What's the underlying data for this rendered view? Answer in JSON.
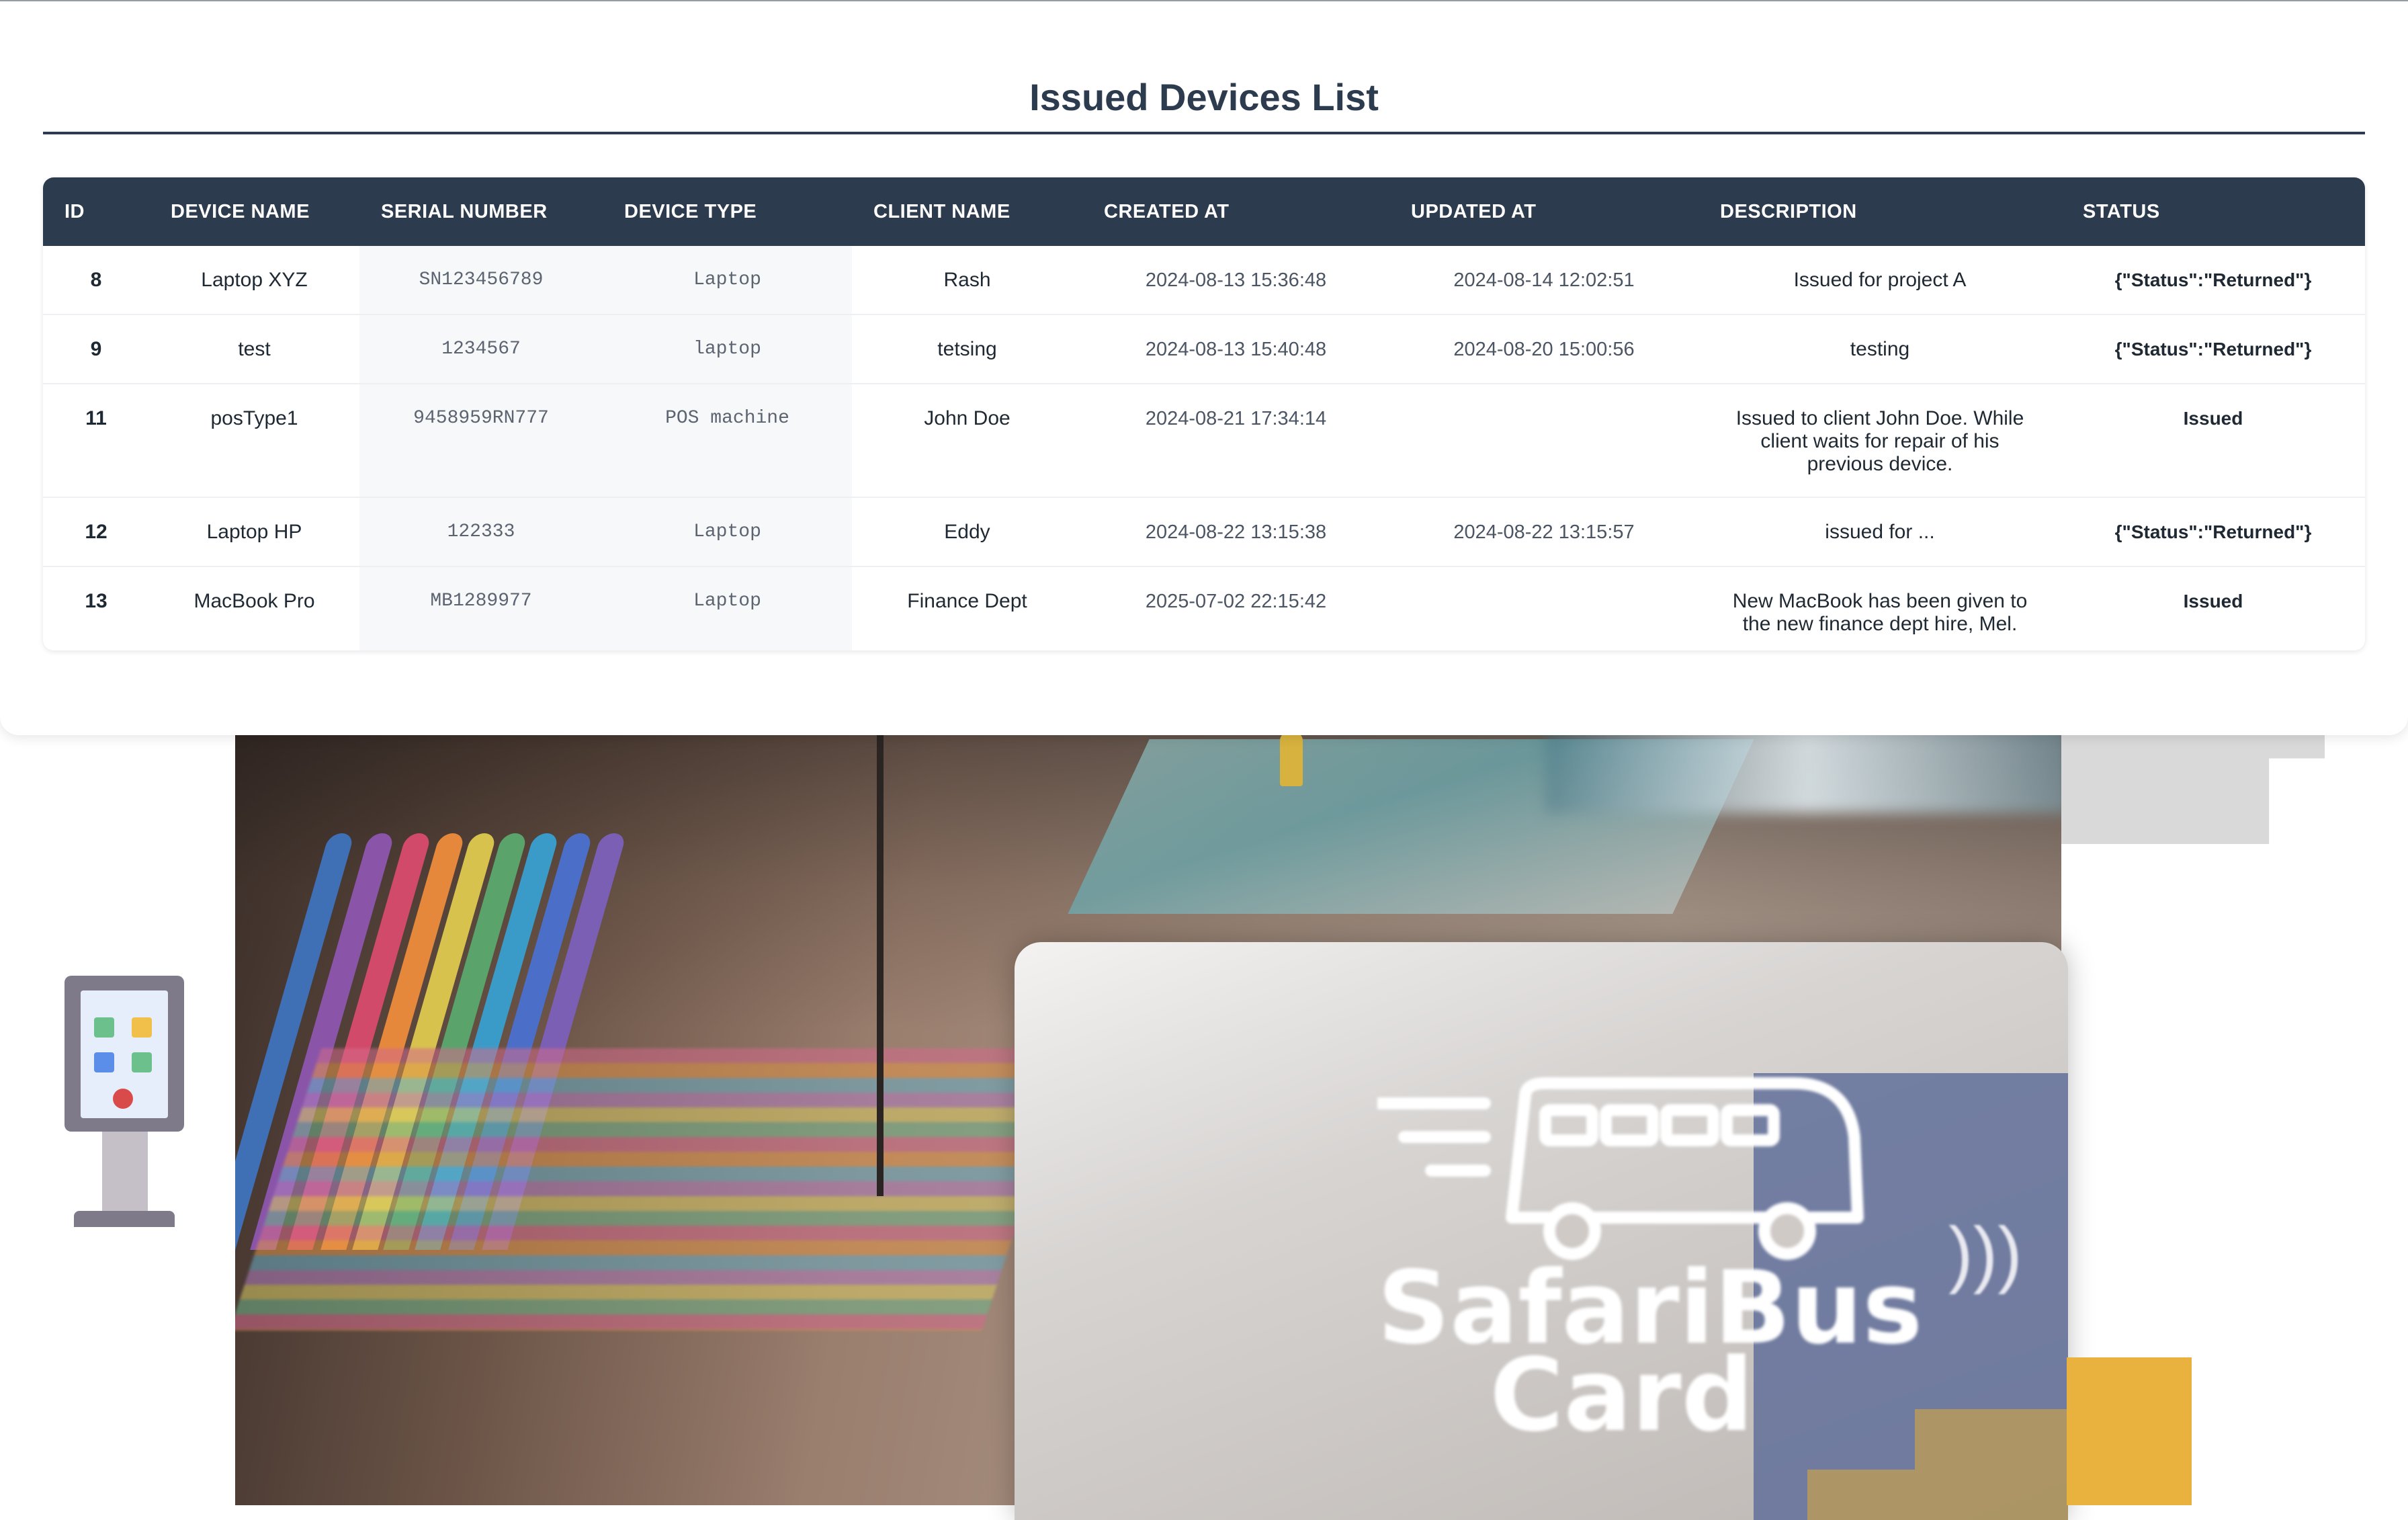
{
  "page": {
    "title": "Issued Devices List"
  },
  "table": {
    "columns": [
      "ID",
      "DEVICE NAME",
      "SERIAL NUMBER",
      "DEVICE TYPE",
      "CLIENT NAME",
      "CREATED AT",
      "UPDATED AT",
      "DESCRIPTION",
      "STATUS"
    ],
    "rows": [
      {
        "id": "8",
        "device_name": "Laptop XYZ",
        "serial": "SN123456789",
        "type": "Laptop",
        "client": "Rash",
        "created": "2024-08-13 15:36:48",
        "updated": "2024-08-14 12:02:51",
        "description": "Issued for project A",
        "status": "{\"Status\":\"Returned\"}"
      },
      {
        "id": "9",
        "device_name": "test",
        "serial": "1234567",
        "type": "laptop",
        "client": "tetsing",
        "created": "2024-08-13 15:40:48",
        "updated": "2024-08-20 15:00:56",
        "description": "testing",
        "status": "{\"Status\":\"Returned\"}"
      },
      {
        "id": "11",
        "device_name": "posType1",
        "serial": "9458959RN777",
        "type": "POS machine",
        "client": "John Doe",
        "created": "2024-08-21 17:34:14",
        "updated": "",
        "description": "Issued to client John Doe. While client waits for repair of his previous device.",
        "status": "Issued"
      },
      {
        "id": "12",
        "device_name": "Laptop HP",
        "serial": "122333",
        "type": "Laptop",
        "client": "Eddy",
        "created": "2024-08-22 13:15:38",
        "updated": "2024-08-22 13:15:57",
        "description": "issued for ...",
        "status": "{\"Status\":\"Returned\"}"
      },
      {
        "id": "13",
        "device_name": "MacBook Pro",
        "serial": "MB1289977",
        "type": "Laptop",
        "client": "Finance Dept",
        "created": "2025-07-02 22:15:42",
        "updated": "",
        "description": "New MacBook has been given to the new finance dept hire, Mel.",
        "status": "Issued"
      }
    ]
  },
  "hero": {
    "card_brand_line1": "SafariBus",
    "card_brand_line2": "Card",
    "nfc_icon": "contactless-icon",
    "kiosk_icon": "kiosk-icon"
  },
  "colors": {
    "header_bg": "#2d3b4e",
    "accent_gold": "#e9b13e",
    "card_navy": "#62709a"
  }
}
